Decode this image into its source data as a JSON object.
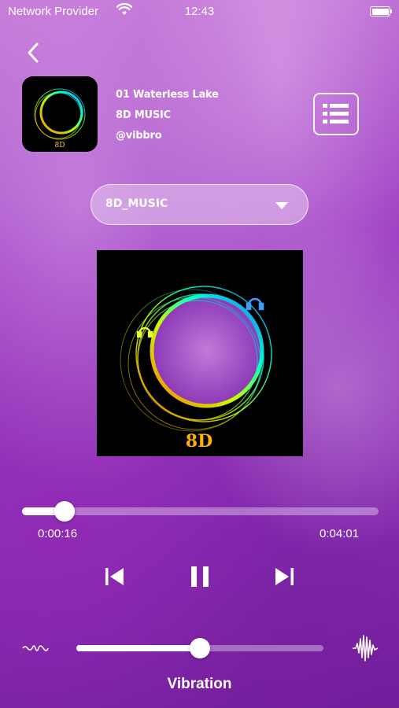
{
  "status_bar": {
    "carrier": "Network Provider",
    "time": "12:43"
  },
  "track": {
    "title": "01 Waterless Lake",
    "artist": "8D MUSIC",
    "handle": "@vibbro"
  },
  "selector": {
    "label": "8D_MUSIC"
  },
  "artwork": {
    "label": "8D"
  },
  "progress": {
    "elapsed": "0:00:16",
    "total": "0:04:01",
    "fraction": 0.066
  },
  "vibration": {
    "label": "Vibration",
    "level": 0.5
  },
  "icons": {
    "back": "chevron-left-icon",
    "playlist": "playlist-icon",
    "previous": "skip-previous-icon",
    "pause": "pause-icon",
    "next": "skip-next-icon",
    "vibration_low": "soft-wave-icon",
    "vibration_high": "strong-wave-icon"
  },
  "colors": {
    "background": "#9a3fc2",
    "accent": "#ffffff"
  }
}
